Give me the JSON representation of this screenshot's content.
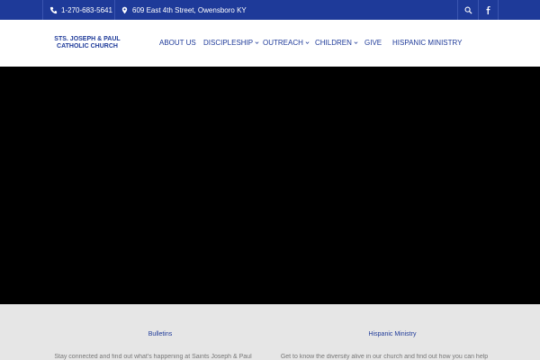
{
  "topbar": {
    "phone": "1-270-683-5641",
    "address": "609 East 4th Street, Owensboro KY",
    "phone_icon": "phone-icon",
    "location_icon": "map-pin-icon",
    "search_icon": "search-icon",
    "facebook_icon": "facebook-icon",
    "background_color": "#1e3a99"
  },
  "header": {
    "logo_line1": "STS. JOSEPH & PAUL",
    "logo_line2": "CATHOLIC CHURCH",
    "nav": {
      "about": "ABOUT US",
      "discipleship": "DISCIPLESHIP",
      "outreach": "OUTREACH",
      "children": "CHILDREN",
      "give": "GIVE",
      "hispanic": "HISPANIC MINISTRY"
    },
    "dropdown_icon": "chevron-down-icon"
  },
  "hero": {
    "background_color": "#000000"
  },
  "cards": {
    "bulletins": {
      "title": "Bulletins",
      "text": "Stay connected and find out what's happening at Saints Joseph & Paul"
    },
    "hispanic": {
      "title": "Hispanic Ministry",
      "text": "Get to know the diversity alive in our church and find out how you can help"
    }
  }
}
